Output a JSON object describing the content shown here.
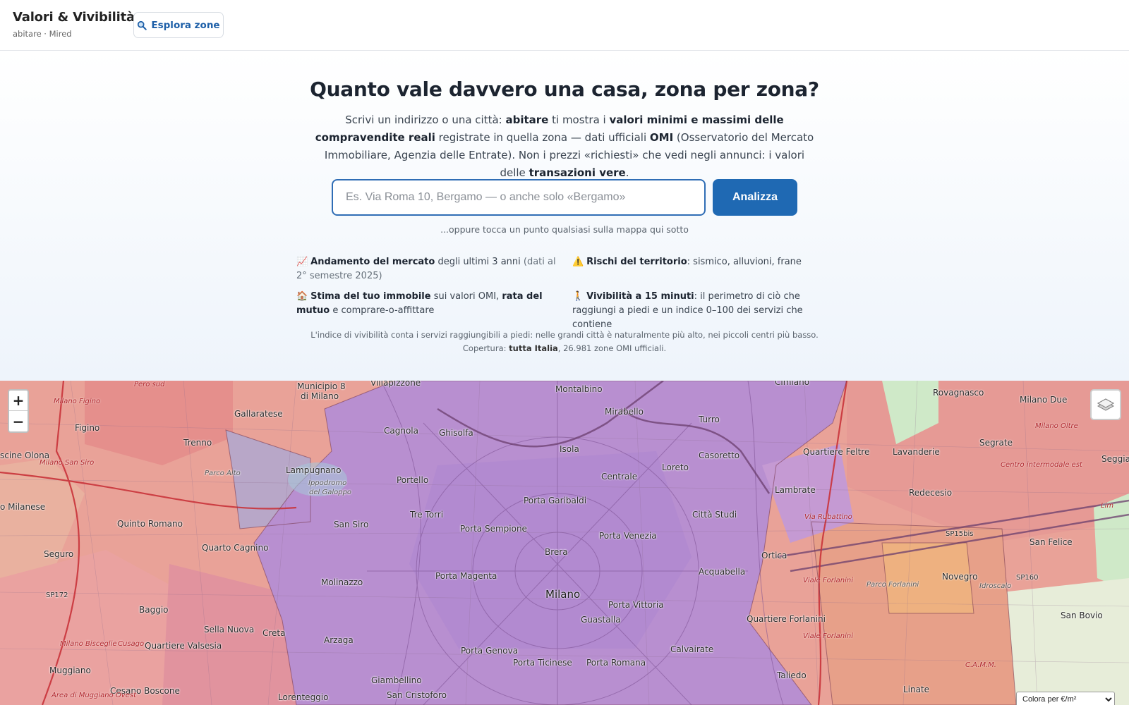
{
  "header": {
    "title": "Valori & Vivibilità",
    "subtitle": "abitare · Mired",
    "explore_label": "Esplora zone"
  },
  "hero": {
    "title": "Quanto vale davvero una casa, zona per zona?",
    "desc": {
      "p1": "Scrivi un indirizzo o una città: ",
      "b1": "abitare",
      "p2": " ti mostra i ",
      "b2": "valori minimi e massimi delle compravendite reali",
      "p3": " registrate in quella zona — dati ufficiali ",
      "b3": "OMI",
      "p4": " (Osservatorio del Mercato Immobiliare, Agenzia delle Entrate). Non i prezzi «richiesti» che vedi negli annunci: i valori delle ",
      "b4": "transazioni vere",
      "p5": "."
    },
    "search_placeholder": "Es. Via Roma 10, Bergamo — o anche solo «Bergamo»",
    "analyze_label": "Analizza",
    "hint": "...oppure tocca un punto qualsiasi sulla mappa qui sotto"
  },
  "features": {
    "market": {
      "icon": "📈",
      "bold": "Andamento del mercato",
      "text": " degli ultimi 3 anni ",
      "note": "(dati al 2° semestre 2025)"
    },
    "risks": {
      "icon": "⚠️",
      "bold": "Rischi del territorio",
      "text": ": sismico, alluvioni, frane"
    },
    "estimate": {
      "icon": "🏠",
      "bold": "Stima del tuo immobile",
      "text1": " sui valori OMI, ",
      "bold2": "rata del mutuo",
      "text2": " e comprare-o-affittare"
    },
    "livability": {
      "icon": "🚶",
      "bold": "Vivibilità a 15 minuti",
      "text": ": il perimetro di ciò che raggiungi a piedi e un indice 0–100 dei servizi che contiene"
    }
  },
  "disclaimer": {
    "line1": "L'indice di vivibilità conta i servizi raggiungibili a piedi: nelle grandi città è naturalmente più alto, nei piccoli centri più basso.",
    "line2_prefix": "Copertura: ",
    "line2_bold": "tutta Italia",
    "line2_suffix": ", 26.981 zone OMI ufficiali."
  },
  "map": {
    "zoom_in": "+",
    "zoom_out": "−",
    "color_select": "Colora per €/m²",
    "colors": {
      "high": "#b58fd0",
      "mid": "#d88ea3",
      "low": "#ec9c92",
      "green": "#cfe9c8"
    },
    "labels": {
      "municipio8": "Municipio 8",
      "dimilano": "di Milano",
      "villapizzone": "Villapizzone",
      "perosud": "Pero sud",
      "milanofigino": "Milano Figino",
      "gallaratese": "Gallaratese",
      "cagnola": "Cagnola",
      "ghisolfa": "Ghisolfa",
      "montalbino": "Montalbino",
      "mirabello": "Mirabello",
      "turro": "Turro",
      "cimiano": "Cimiano",
      "milanodue": "Milano Due",
      "rovagnasco": "Rovagnasco",
      "figino": "Figino",
      "trenno": "Trenno",
      "isola": "Isola",
      "casoretto": "Casoretto",
      "quartierefeltre": "Quartiere Feltre",
      "lavanderie": "Lavanderie",
      "segrate": "Segrate",
      "milanooltre": "Milano Oltre",
      "seggia": "Seggia",
      "scineolona": "scine Olona",
      "milanosansiro": "Milano San Siro",
      "lampugnano": "Lampugnano",
      "parcoalto": "Parco Alto",
      "ippodromo": "Ippodromo",
      "delgaloppo": "del Galoppo",
      "portello": "Portello",
      "centrale": "Centrale",
      "loreto": "Loreto",
      "lambrate": "Lambrate",
      "redecesio": "Redecesio",
      "portagaribaldi": "Porta Garibaldi",
      "milanese": "o Milanese",
      "quintoromano": "Quinto Romano",
      "trettorri": "Tre Torri",
      "sansiro": "San Siro",
      "cittastudi": "Città Studi",
      "portasempione": "Porta Sempione",
      "portavenezia": "Porta Venezia",
      "seguro": "Seguro",
      "quartocagnino": "Quarto Cagnino",
      "brera": "Brera",
      "ortica": "Ortica",
      "sanfelice": "San Felice",
      "acquabella": "Acquabella",
      "portamagenta": "Porta Magenta",
      "novegro": "Novegro",
      "molinazzo": "Molinazzo",
      "milano": "Milano",
      "portavittoria": "Porta Vittoria",
      "baggio": "Baggio",
      "guastalla": "Guastalla",
      "quartiereforlanini": "Quartiere Forlanini",
      "sanbovio": "San Bovio",
      "sellanuova": "Sella Nuova",
      "creta": "Creta",
      "quartierevalsesia": "Quartiere Valsesia",
      "arzaga": "Arzaga",
      "calvairate": "Calvairate",
      "portagenova": "Porta Genova",
      "portaticinese": "Porta Ticinese",
      "portaromana": "Porta Romana",
      "muggiano": "Muggiano",
      "giambellino": "Giambellino",
      "taliedo": "Taliedo",
      "cesanoboscone": "Cesano Boscone",
      "lorenteggio": "Lorenteggio",
      "sancristoforo": "San Cristoforo",
      "linate": "Linate",
      "parcoforlanini": "Parco Forlanini",
      "idroscalo": "Idroscalo",
      "sp15bis": "SP15bis",
      "sp160": "SP160",
      "sp172": "SP172",
      "viaforlanini": "Viale Forlanini",
      "viarubattino": "Via Rubattino",
      "milanobisceglie": "Milano Bisceglie",
      "cusago": "Cusago",
      "areadimuggiano": "Area di Muggiano Ovest",
      "centrointermodale": "Centro intermodale est",
      "linate2": "Lim",
      "cam": "C.A.M.M."
    }
  }
}
